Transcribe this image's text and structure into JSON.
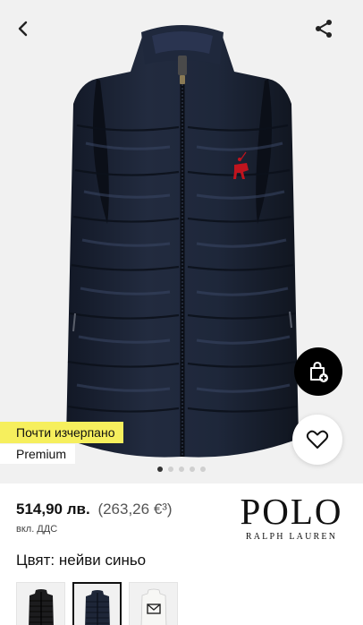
{
  "product": {
    "price_main": "514,90 лв.",
    "price_eur": "(263,26 €³)",
    "vat_note": "вкл. ДДС",
    "color_label": "Цвят: нейви синьо"
  },
  "badges": {
    "stock": "Почти изчерпано",
    "premium": "Premium"
  },
  "brand": {
    "name": "POLO",
    "sub": "RALPH LAUREN"
  },
  "carousel": {
    "dots_total": 5,
    "active_index": 0
  },
  "thumbnails": [
    {
      "name": "thumb-black-vest",
      "selected": false
    },
    {
      "name": "thumb-navy-vest",
      "selected": true
    },
    {
      "name": "thumb-white-vest",
      "selected": false
    }
  ],
  "icons": {
    "back": "chevron-left-icon",
    "share": "share-icon",
    "bag": "shopping-bag-add-icon",
    "wish": "heart-icon"
  },
  "colors": {
    "vest": "#1b2233",
    "stock_badge": "#f6ef5d",
    "accent": "#000000",
    "logo_red": "#c0141e"
  }
}
